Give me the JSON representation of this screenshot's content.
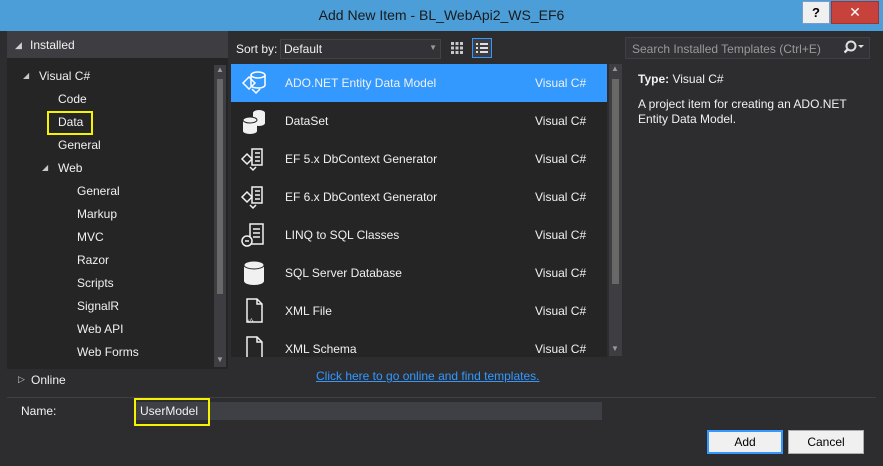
{
  "window": {
    "title": "Add New Item - BL_WebApi2_WS_EF6",
    "help_label": "?",
    "close_label": "✕"
  },
  "tree": {
    "header": "Installed",
    "root": "Visual C#",
    "level1": [
      "Code",
      "Data",
      "General",
      "Web"
    ],
    "web_children": [
      "General",
      "Markup",
      "MVC",
      "Razor",
      "Scripts",
      "SignalR",
      "Web API",
      "Web Forms"
    ],
    "online": "Online"
  },
  "toolbar": {
    "sort_label": "Sort by:",
    "sort_value": "Default"
  },
  "templates": [
    {
      "name": "ADO.NET Entity Data Model",
      "lang": "Visual C#",
      "icon": "entity-model-icon",
      "selected": true
    },
    {
      "name": "DataSet",
      "lang": "Visual C#",
      "icon": "dataset-icon"
    },
    {
      "name": "EF 5.x DbContext Generator",
      "lang": "Visual C#",
      "icon": "generator-icon"
    },
    {
      "name": "EF 6.x DbContext Generator",
      "lang": "Visual C#",
      "icon": "generator-icon"
    },
    {
      "name": "LINQ to SQL Classes",
      "lang": "Visual C#",
      "icon": "linq-icon"
    },
    {
      "name": "SQL Server Database",
      "lang": "Visual C#",
      "icon": "database-icon"
    },
    {
      "name": "XML File",
      "lang": "Visual C#",
      "icon": "xml-file-icon"
    },
    {
      "name": "XML Schema",
      "lang": "Visual C#",
      "icon": "xml-schema-icon"
    }
  ],
  "online_link": "Click here to go online and find templates.",
  "search": {
    "placeholder": "Search Installed Templates (Ctrl+E)"
  },
  "description": {
    "type_key": "Type:",
    "type_value": "Visual C#",
    "text": "A project item for creating an ADO.NET Entity Data Model."
  },
  "name_field": {
    "label": "Name:",
    "value": "UserModel"
  },
  "buttons": {
    "add": "Add",
    "cancel": "Cancel"
  },
  "colors": {
    "accent": "#3399ff",
    "highlight_box": "#f6f300",
    "title_bar": "#4c9ed9"
  }
}
